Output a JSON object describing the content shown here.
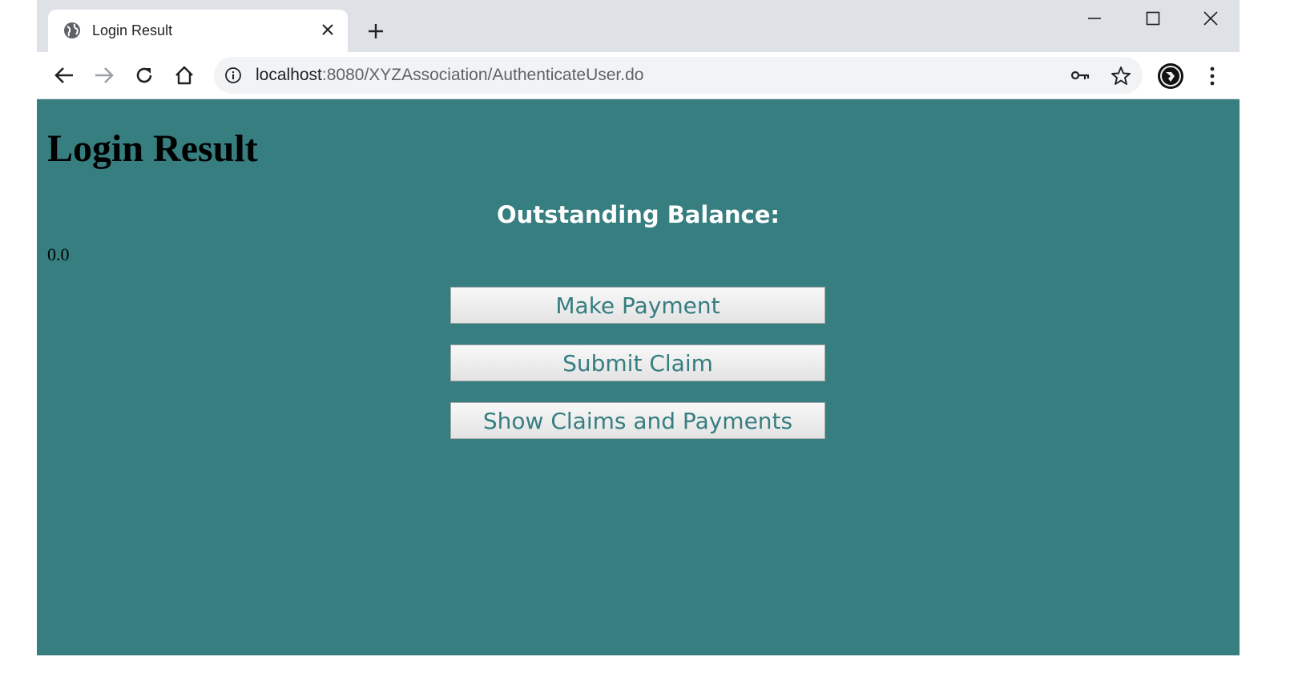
{
  "browser": {
    "tab_title": "Login Result",
    "url_host": "localhost",
    "url_rest": ":8080/XYZAssociation/AuthenticateUser.do",
    "icons": [
      "globe-icon",
      "close-icon",
      "plus-icon",
      "minimize-icon",
      "maximize-icon",
      "window-close-icon",
      "back-arrow-icon",
      "forward-arrow-icon",
      "reload-icon",
      "home-icon",
      "info-icon",
      "key-icon",
      "star-icon",
      "avatar",
      "more-vert-icon"
    ]
  },
  "page": {
    "heading": "Login Result",
    "balance_label": "Outstanding Balance:",
    "balance_value": "0.0",
    "buttons": {
      "make_payment": "Make Payment",
      "submit_claim": "Submit Claim",
      "show_claims": "Show Claims and Payments"
    }
  },
  "colors": {
    "page_background": "#377e80",
    "button_text": "#377e80",
    "tab_strip": "#dee1e6",
    "omnibox": "#f1f3f4"
  }
}
